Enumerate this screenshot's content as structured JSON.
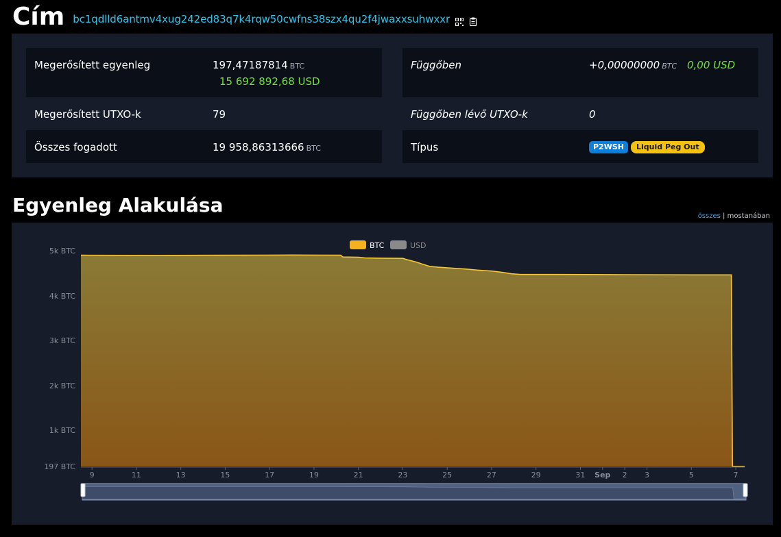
{
  "header": {
    "title": "Cím",
    "address": "bc1qdlld6antmv4xug242ed83q7k4rqw50cwfns38szx4qu2f4jwaxxsuhwxxr",
    "qr_icon": "qr-code-icon",
    "copy_icon": "clipboard-icon"
  },
  "summary": {
    "confirmed_balance_label": "Megerősített egyenleg",
    "confirmed_balance_value": "197,47187814",
    "confirmed_balance_unit": "BTC",
    "confirmed_balance_usd": "15 692 892,68 USD",
    "pending_label": "Függőben",
    "pending_value": "+0,00000000",
    "pending_unit": "BTC",
    "pending_usd": "0,00 USD",
    "confirmed_utxo_label": "Megerősített UTXO-k",
    "confirmed_utxo_value": "79",
    "pending_utxo_label": "Függőben lévő UTXO-k",
    "pending_utxo_value": "0",
    "total_received_label": "Összes fogadott",
    "total_received_value": "19 958,86313666",
    "total_received_unit": "BTC",
    "type_label": "Típus",
    "type_badges": [
      "P2WSH",
      "Liquid Peg Out"
    ]
  },
  "history": {
    "title": "Egyenleg Alakulása",
    "range_all": "összes",
    "range_sep": "|",
    "range_recent": "mostanában"
  },
  "colors": {
    "accent": "#2ec6ee",
    "usd_green": "#6fe233",
    "btc_line": "#f5c63c",
    "badge_blue": "#0d7fd9",
    "badge_yellow": "#f5c211"
  },
  "chart_data": {
    "type": "area",
    "legend": [
      {
        "name": "BTC",
        "color": "#f6b21e",
        "active": true
      },
      {
        "name": "USD",
        "color": "#8a8a8a",
        "active": false
      }
    ],
    "y_ticks": [
      {
        "label": "5k BTC",
        "value": 4900
      },
      {
        "label": "4k BTC",
        "value": 3900
      },
      {
        "label": "3k BTC",
        "value": 2900
      },
      {
        "label": "2k BTC",
        "value": 1900
      },
      {
        "label": "1k BTC",
        "value": 900
      },
      {
        "label": "197 BTC",
        "value": 197
      }
    ],
    "ylim": [
      197,
      4900
    ],
    "x_ticks": [
      {
        "label": "9",
        "day": 9,
        "bold": false
      },
      {
        "label": "11",
        "day": 11,
        "bold": false
      },
      {
        "label": "13",
        "day": 13,
        "bold": false
      },
      {
        "label": "15",
        "day": 15,
        "bold": false
      },
      {
        "label": "17",
        "day": 17,
        "bold": false
      },
      {
        "label": "19",
        "day": 19,
        "bold": false
      },
      {
        "label": "21",
        "day": 21,
        "bold": false
      },
      {
        "label": "23",
        "day": 23,
        "bold": false
      },
      {
        "label": "25",
        "day": 25,
        "bold": false
      },
      {
        "label": "27",
        "day": 27,
        "bold": false
      },
      {
        "label": "29",
        "day": 29,
        "bold": false
      },
      {
        "label": "31",
        "day": 31,
        "bold": false
      },
      {
        "label": "Sep",
        "day": 32,
        "bold": true
      },
      {
        "label": "2",
        "day": 33,
        "bold": false
      },
      {
        "label": "3",
        "day": 34,
        "bold": false
      },
      {
        "label": "5",
        "day": 36,
        "bold": false
      },
      {
        "label": "7",
        "day": 38,
        "bold": false
      }
    ],
    "xlim": [
      8.5,
      38.4
    ],
    "series": [
      {
        "name": "BTC",
        "points": [
          [
            8.5,
            4800
          ],
          [
            12.0,
            4795
          ],
          [
            16.0,
            4800
          ],
          [
            18.0,
            4805
          ],
          [
            19.5,
            4802
          ],
          [
            20.2,
            4800
          ],
          [
            20.3,
            4760
          ],
          [
            21.0,
            4755
          ],
          [
            21.3,
            4740
          ],
          [
            22.0,
            4735
          ],
          [
            23.0,
            4730
          ],
          [
            23.2,
            4700
          ],
          [
            23.6,
            4650
          ],
          [
            23.9,
            4600
          ],
          [
            24.2,
            4555
          ],
          [
            24.6,
            4535
          ],
          [
            25.2,
            4515
          ],
          [
            25.8,
            4495
          ],
          [
            26.4,
            4470
          ],
          [
            27.0,
            4450
          ],
          [
            27.5,
            4420
          ],
          [
            27.9,
            4390
          ],
          [
            28.3,
            4375
          ],
          [
            30.0,
            4375
          ],
          [
            33.0,
            4370
          ],
          [
            36.0,
            4365
          ],
          [
            37.8,
            4365
          ],
          [
            37.85,
            197
          ],
          [
            38.4,
            197
          ]
        ]
      }
    ]
  }
}
